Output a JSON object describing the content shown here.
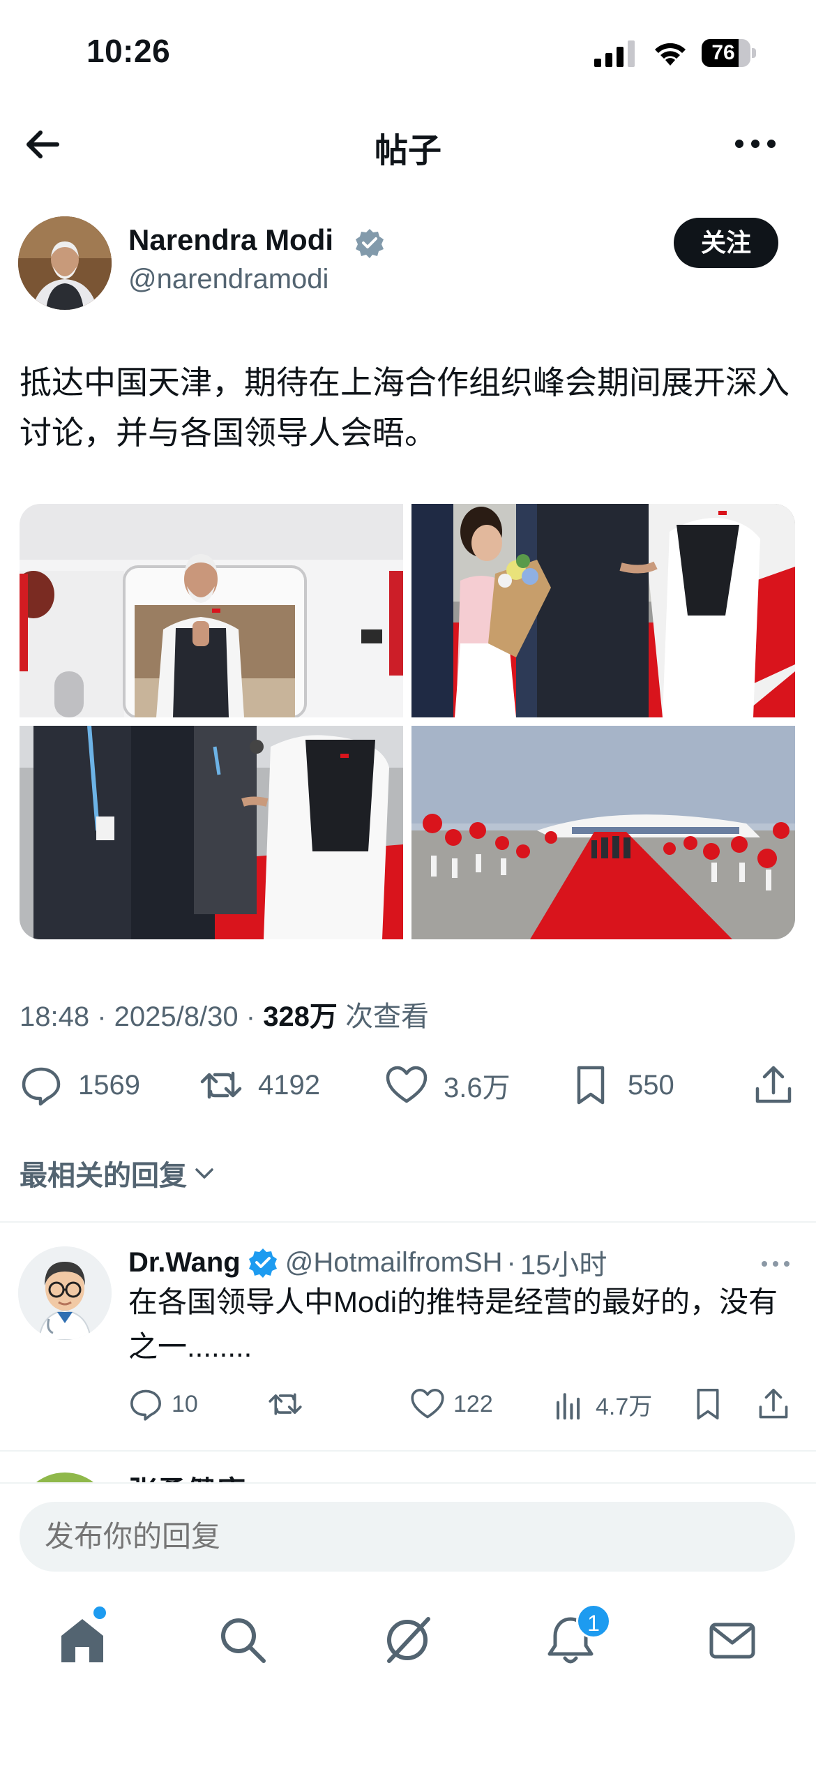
{
  "status_bar": {
    "time": "10:26",
    "battery": "76",
    "battery_level": 0.76
  },
  "header": {
    "title": "帖子"
  },
  "author": {
    "name": "Narendra Modi",
    "handle": "@narendramodi",
    "follow_label": "关注"
  },
  "tweet": {
    "text": "抵达中国天津，期待在上海合作组织峰会期间展开深入讨论，并与各国领导人会晤。",
    "time": "18:48",
    "date": "2025/8/30",
    "views_count": "328万",
    "views_label": "次查看"
  },
  "actions": {
    "replies": "1569",
    "retweets": "4192",
    "likes": "3.6万",
    "bookmarks": "550"
  },
  "replies_section": {
    "label": "最相关的回复"
  },
  "reply": {
    "name": "Dr.Wang",
    "handle": "@HotmailfromSH",
    "time": "15小时",
    "text": "在各国领导人中Modi的推特是经营的最好的，没有之一........",
    "replies": "10",
    "likes": "122",
    "views": "4.7万"
  },
  "next_reply_peek": "张勇健康",
  "composer": {
    "placeholder": "发布你的回复"
  },
  "tab_bar": {
    "notification_badge": "1"
  },
  "colors": {
    "accent": "#1d9bf0",
    "text": "#0f1419",
    "secondary": "#536471",
    "red_carpet": "#d9141c"
  }
}
